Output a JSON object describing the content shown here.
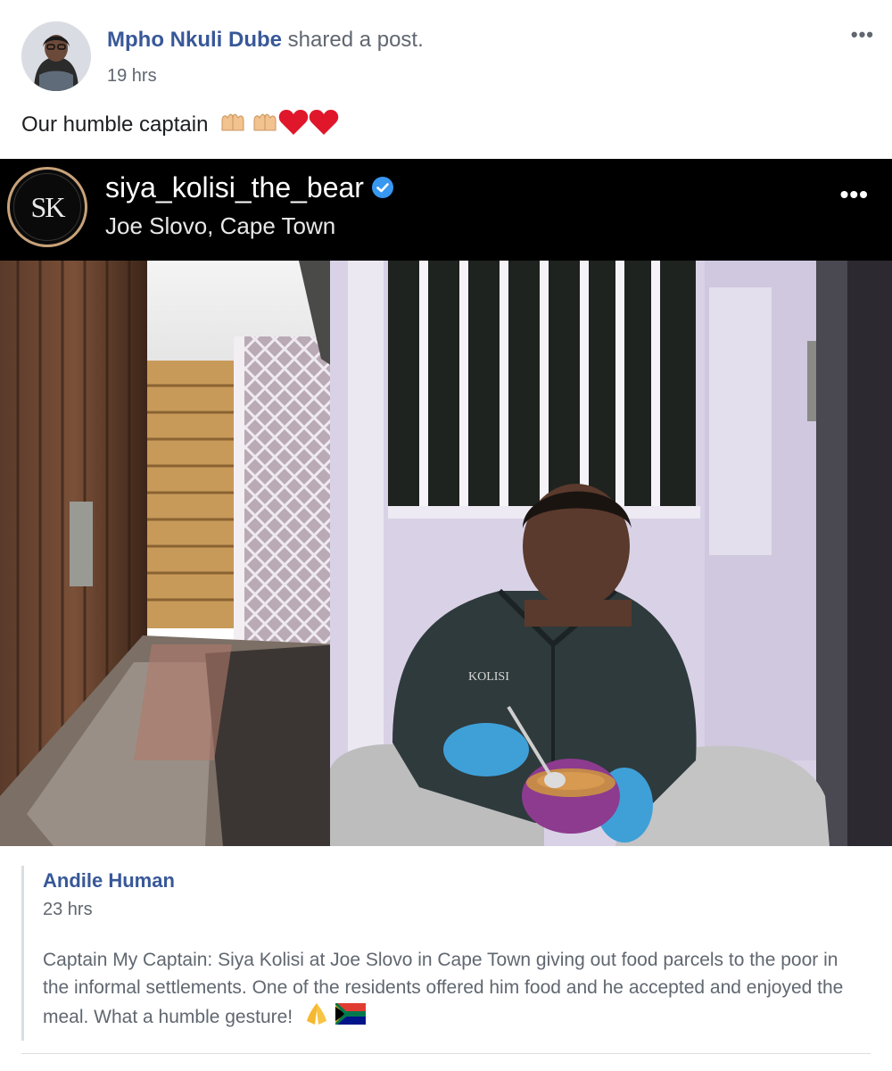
{
  "post": {
    "author_name": "Mpho Nkuli Dube",
    "action_text": " shared a post.",
    "time": "19 hrs",
    "caption": "Our humble captain",
    "caption_emojis": [
      "raised-hands-emoji",
      "raised-hands-emoji",
      "red-heart-emoji",
      "red-heart-emoji"
    ],
    "menu_icon": "more-options-icon"
  },
  "embed": {
    "logo_text": "SK",
    "username": "siya_kolisi_the_bear",
    "verified": true,
    "location": "Joe Slovo, Cape Town",
    "menu_icon": "more-options-icon",
    "colors": {
      "background": "#000000",
      "logo_ring": "#c8a27a",
      "verified": "#3897f0"
    }
  },
  "shared": {
    "author_name": "Andile Human",
    "time": "23 hrs",
    "text": "Captain My Captain: Siya Kolisi at Joe Slovo in Cape Town giving out food parcels to the poor in the informal settlements. One of the residents offered him food and he accepted and enjoyed the meal. What a humble gesture!",
    "text_emojis": [
      "folded-hands-emoji",
      "south-africa-flag-emoji"
    ]
  },
  "colors": {
    "link": "#385898",
    "secondary_text": "#606770",
    "divider": "#dadde1"
  }
}
